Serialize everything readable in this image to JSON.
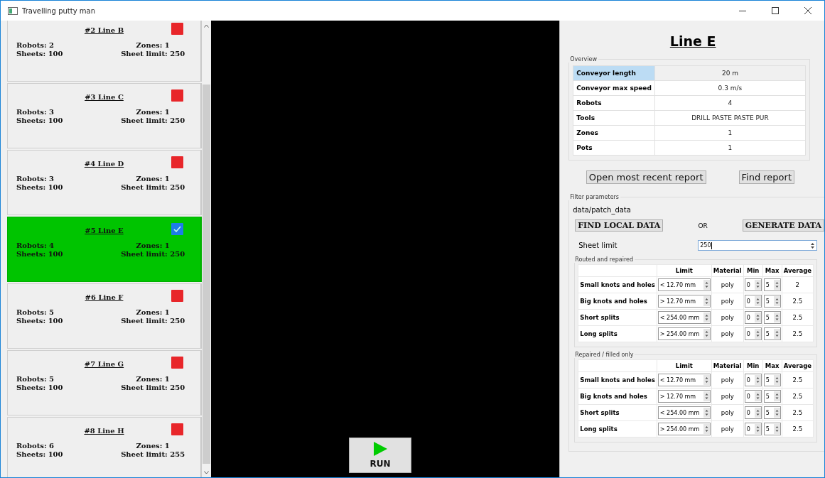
{
  "window": {
    "title": "Travelling putty man"
  },
  "lines": [
    {
      "title": "#2 Line B",
      "robots": "Robots: 2",
      "sheets": "Sheets: 100",
      "zones": "Zones: 1",
      "sheet_limit": "Sheet limit: 250",
      "selected": false
    },
    {
      "title": "#3 Line C",
      "robots": "Robots: 3",
      "sheets": "Sheets: 100",
      "zones": "Zones: 1",
      "sheet_limit": "Sheet limit: 250",
      "selected": false
    },
    {
      "title": "#4 Line D",
      "robots": "Robots: 3",
      "sheets": "Sheets: 100",
      "zones": "Zones: 1",
      "sheet_limit": "Sheet limit: 250",
      "selected": false
    },
    {
      "title": "#5 Line E",
      "robots": "Robots: 4",
      "sheets": "Sheets: 100",
      "zones": "Zones: 1",
      "sheet_limit": "Sheet limit: 250",
      "selected": true
    },
    {
      "title": "#6 Line F",
      "robots": "Robots: 5",
      "sheets": "Sheets: 100",
      "zones": "Zones: 1",
      "sheet_limit": "Sheet limit: 250",
      "selected": false
    },
    {
      "title": "#7 Line G",
      "robots": "Robots: 5",
      "sheets": "Sheets: 100",
      "zones": "Zones: 1",
      "sheet_limit": "Sheet limit: 250",
      "selected": false
    },
    {
      "title": "#8 Line H",
      "robots": "Robots: 6",
      "sheets": "Sheets: 100",
      "zones": "Zones: 1",
      "sheet_limit": "Sheet limit: 255",
      "selected": false
    }
  ],
  "run_button": {
    "label": "RUN"
  },
  "detail": {
    "title": "Line E",
    "overview": {
      "label": "Overview",
      "rows": [
        {
          "name": "Conveyor length",
          "value": "20 m",
          "selected": true
        },
        {
          "name": "Conveyor max speed",
          "value": "0.3 m/s",
          "selected": false
        },
        {
          "name": "Robots",
          "value": "4",
          "selected": false
        },
        {
          "name": "Tools",
          "value": "DRILL PASTE PASTE PUR",
          "selected": false
        },
        {
          "name": "Zones",
          "value": "1",
          "selected": false
        },
        {
          "name": "Pots",
          "value": "1",
          "selected": false
        }
      ]
    },
    "report_buttons": [
      "Open most recent report",
      "Find report"
    ],
    "filter": {
      "label": "Filter parameters",
      "path": "data/patch_data",
      "find_button": "FIND LOCAL DATA",
      "or": "OR",
      "generate_button": "GENERATE DATA",
      "sheet_limit_label": "Sheet limit",
      "sheet_limit_value": "250",
      "groups": [
        {
          "label": "Routed and repaired",
          "columns": [
            "Limit",
            "Material",
            "Min",
            "Max",
            "Average"
          ],
          "rows": [
            {
              "name": "Small knots and holes",
              "limit": "< 12.70 mm",
              "material": "poly",
              "min": "0",
              "max": "5",
              "average": "2"
            },
            {
              "name": "Big knots and holes",
              "limit": "> 12.70 mm",
              "material": "poly",
              "min": "0",
              "max": "5",
              "average": "2.5"
            },
            {
              "name": "Short splits",
              "limit": "< 254.00 mm",
              "material": "poly",
              "min": "0",
              "max": "5",
              "average": "2.5"
            },
            {
              "name": "Long splits",
              "limit": "> 254.00 mm",
              "material": "poly",
              "min": "0",
              "max": "5",
              "average": "2.5"
            }
          ]
        },
        {
          "label": "Repaired / filled only",
          "columns": [
            "Limit",
            "Material",
            "Min",
            "Max",
            "Average"
          ],
          "rows": [
            {
              "name": "Small knots and holes",
              "limit": "< 12.70 mm",
              "material": "poly",
              "min": "0",
              "max": "5",
              "average": "2.5"
            },
            {
              "name": "Big knots and holes",
              "limit": "> 12.70 mm",
              "material": "poly",
              "min": "0",
              "max": "5",
              "average": "2.5"
            },
            {
              "name": "Short splits",
              "limit": "< 254.00 mm",
              "material": "poly",
              "min": "0",
              "max": "5",
              "average": "2.5"
            },
            {
              "name": "Long splits",
              "limit": "> 254.00 mm",
              "material": "poly",
              "min": "0",
              "max": "5",
              "average": "2.5"
            }
          ]
        }
      ]
    }
  }
}
